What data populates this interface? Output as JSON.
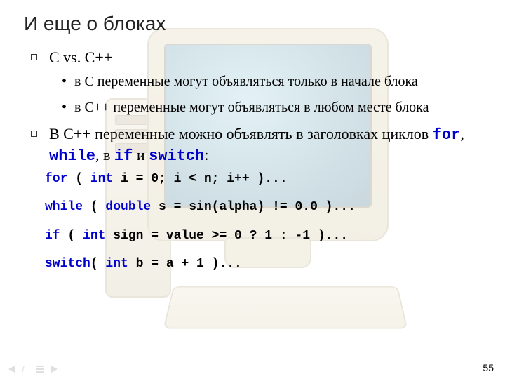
{
  "title": "И еще о блоках",
  "bullets": {
    "b1": "С vs. C++",
    "b1_sub1": "в C переменные могут объявляться только в начале блока",
    "b1_sub2": "в C++ переменные могут объявляться в любом месте блока",
    "b2_pre": "В C++ переменные можно объявлять в заголовках циклов ",
    "b2_kw_for": "for",
    "b2_sep1": ", ",
    "b2_kw_while": "while",
    "b2_sep2": ", в ",
    "b2_kw_if": "if",
    "b2_sep3": " и ",
    "b2_kw_switch": "switch",
    "b2_post": ":"
  },
  "code": {
    "l1_kw1": "for",
    "l1_t1": " ( ",
    "l1_kw2": "int",
    "l1_t2": " i = 0; i < n; i++ )...",
    "l2_kw1": "while",
    "l2_t1": " ( ",
    "l2_kw2": "double",
    "l2_t2": " s = sin(alpha) != 0.0 )...",
    "l3_kw1": "if",
    "l3_t1": " ( ",
    "l3_kw2": "int",
    "l3_t2": " sign = value >= 0 ? 1 : -1 )...",
    "l4_kw1": "switch",
    "l4_t1": "( ",
    "l4_kw2": "int",
    "l4_t2": " b = a + 1 )..."
  },
  "page_number": "55"
}
